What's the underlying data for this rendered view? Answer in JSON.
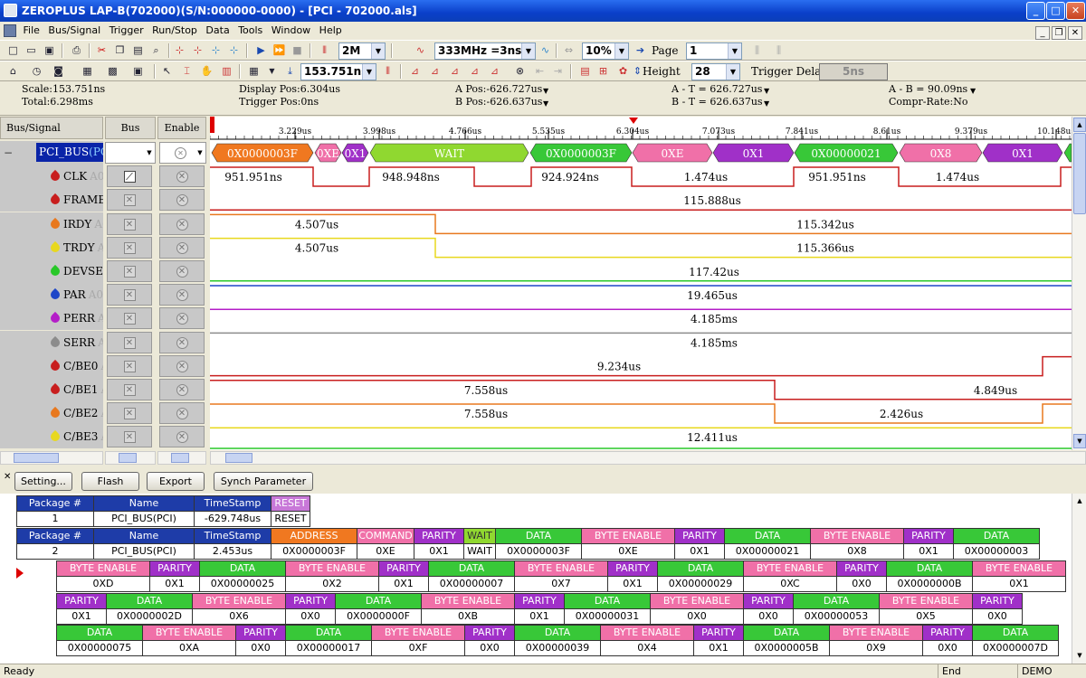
{
  "window": {
    "title": "ZEROPLUS LAP-B(702000)(S/N:000000-0000) - [PCI - 702000.als]",
    "min": "_",
    "max": "□",
    "close": "✕"
  },
  "menu": [
    "File",
    "Bus/Signal",
    "Trigger",
    "Run/Stop",
    "Data",
    "Tools",
    "Window",
    "Help"
  ],
  "mdi": [
    "_",
    "❐",
    "✕"
  ],
  "toolbar1": {
    "memory": "2M",
    "frequency": "333MHz =3ns",
    "trigger_pos": "10%",
    "page_label": "Page",
    "page": "1"
  },
  "toolbar2": {
    "time": "153.751ns",
    "height_label": "Height",
    "height": "28",
    "trigger_delay_label": "Trigger Delay",
    "trigger_delay": "5ns"
  },
  "stats": {
    "scale": "Scale:153.751ns",
    "total": "Total:6.298ms",
    "display_pos": "Display Pos:6.304us",
    "trigger_pos": "Trigger Pos:0ns",
    "a_pos": "A Pos:-626.727us",
    "b_pos": "B Pos:-626.637us",
    "a_t": "A - T = 626.727us",
    "b_t": "B - T = 626.637us",
    "a_b": "A - B = 90.09ns",
    "compr": "Compr-Rate:No"
  },
  "headers": {
    "signal": "Bus/Signal",
    "bus": "Bus",
    "enable": "Enable"
  },
  "bus": {
    "name": "PCI_BUS",
    "suffix": "(PCI)"
  },
  "signals": [
    {
      "name": "CLK",
      "ch": "A0",
      "color": "#c81e1e"
    },
    {
      "name": "FRAME",
      "ch": "",
      "color": "#c81e1e"
    },
    {
      "name": "IRDY",
      "ch": "A0",
      "color": "#e8781e"
    },
    {
      "name": "TRDY",
      "ch": "A",
      "color": "#e8d81e"
    },
    {
      "name": "DEVSEL",
      "ch": "",
      "color": "#28c828"
    },
    {
      "name": "PAR",
      "ch": "A0",
      "color": "#1e46c8"
    },
    {
      "name": "PERR",
      "ch": "A0",
      "color": "#b41ec8"
    },
    {
      "name": "SERR",
      "ch": "A",
      "color": "#8c8c8c"
    },
    {
      "name": "C/BE0",
      "ch": "A",
      "color": "#c81e1e"
    },
    {
      "name": "C/BE1",
      "ch": "A",
      "color": "#c81e1e"
    },
    {
      "name": "C/BE2",
      "ch": "A",
      "color": "#e8781e"
    },
    {
      "name": "C/BE3",
      "ch": "A",
      "color": "#e8d81e"
    }
  ],
  "ruler": [
    "3.229us",
    "3.998us",
    "4.766us",
    "5.535us",
    "6.304us",
    "7.073us",
    "7.841us",
    "8.61us",
    "9.379us",
    "10.148us"
  ],
  "bus_segments": [
    {
      "label": "0X0000003F",
      "color": "#f07820"
    },
    {
      "label": "0XE",
      "color": "#f070a8"
    },
    {
      "label": "0X1",
      "color": "#a030c8"
    },
    {
      "label": "WAIT",
      "color": "#90d830"
    },
    {
      "label": "0X0000003F",
      "color": "#38c838"
    },
    {
      "label": "0XE",
      "color": "#f070a8"
    },
    {
      "label": "0X1",
      "color": "#a030c8"
    },
    {
      "label": "0X00000021",
      "color": "#38c838"
    },
    {
      "label": "0X8",
      "color": "#f070a8"
    },
    {
      "label": "0X1",
      "color": "#a030c8"
    }
  ],
  "wave_labels": {
    "clk": [
      "951.951ns",
      "948.948ns",
      "924.924ns",
      "1.474us",
      "951.951ns",
      "1.474us"
    ],
    "frame": "115.888us",
    "irdy": [
      "4.507us",
      "115.342us"
    ],
    "trdy": [
      "4.507us",
      "115.366us"
    ],
    "devsel": "117.42us",
    "par": "19.465us",
    "perr": "4.185ms",
    "serr": "4.185ms",
    "cbe0": "9.234us",
    "cbe1": [
      "7.558us",
      "4.849us"
    ],
    "cbe2": [
      "7.558us",
      "2.426us"
    ],
    "cbe3": "12.411us"
  },
  "buttons": {
    "setting": "Setting...",
    "flash": "Flash",
    "export": "Export",
    "synch": "Synch Parameter"
  },
  "packets": {
    "colors": {
      "header": "#1e3ca8",
      "reset": "#c878d8",
      "address": "#f07820",
      "command": "#f070a8",
      "parity": "#a030c8",
      "wait": "#90d830",
      "data": "#38c838",
      "byte_enable": "#f070a8"
    },
    "p1": {
      "h": [
        "Package #",
        "Name",
        "TimeStamp",
        "RESET"
      ],
      "v": [
        "1",
        "PCI_BUS(PCI)",
        "-629.748us",
        "RESET"
      ]
    },
    "p2": {
      "h": [
        "Package #",
        "Name",
        "TimeStamp",
        "ADDRESS",
        "COMMAND",
        "PARITY",
        "WAIT",
        "DATA",
        "BYTE ENABLE",
        "PARITY",
        "DATA",
        "BYTE ENABLE",
        "PARITY",
        "DATA"
      ],
      "v": [
        "2",
        "PCI_BUS(PCI)",
        "2.453us",
        "0X0000003F",
        "0XE",
        "0X1",
        "WAIT",
        "0X0000003F",
        "0XE",
        "0X1",
        "0X00000021",
        "0X8",
        "0X1",
        "0X00000003"
      ]
    },
    "r3": {
      "h": [
        "BYTE ENABLE",
        "PARITY",
        "DATA",
        "BYTE ENABLE",
        "PARITY",
        "DATA",
        "BYTE ENABLE",
        "PARITY",
        "DATA",
        "BYTE ENABLE",
        "PARITY",
        "DATA",
        "BYTE ENABLE"
      ],
      "v": [
        "0XD",
        "0X1",
        "0X00000025",
        "0X2",
        "0X1",
        "0X00000007",
        "0X7",
        "0X1",
        "0X00000029",
        "0XC",
        "0X0",
        "0X0000000B",
        "0X1"
      ]
    },
    "r4": {
      "h": [
        "PARITY",
        "DATA",
        "BYTE ENABLE",
        "PARITY",
        "DATA",
        "BYTE ENABLE",
        "PARITY",
        "DATA",
        "BYTE ENABLE",
        "PARITY",
        "DATA",
        "BYTE ENABLE",
        "PARITY"
      ],
      "v": [
        "0X1",
        "0X0000002D",
        "0X6",
        "0X0",
        "0X0000000F",
        "0XB",
        "0X1",
        "0X00000031",
        "0X0",
        "0X0",
        "0X00000053",
        "0X5",
        "0X0"
      ]
    },
    "r5": {
      "h": [
        "DATA",
        "BYTE ENABLE",
        "PARITY",
        "DATA",
        "BYTE ENABLE",
        "PARITY",
        "DATA",
        "BYTE ENABLE",
        "PARITY",
        "DATA",
        "BYTE ENABLE",
        "PARITY",
        "DATA"
      ],
      "v": [
        "0X00000075",
        "0XA",
        "0X0",
        "0X00000017",
        "0XF",
        "0X0",
        "0X00000039",
        "0X4",
        "0X1",
        "0X0000005B",
        "0X9",
        "0X0",
        "0X0000007D"
      ]
    }
  },
  "status": {
    "ready": "Ready",
    "end": "End",
    "demo": "DEMO"
  }
}
